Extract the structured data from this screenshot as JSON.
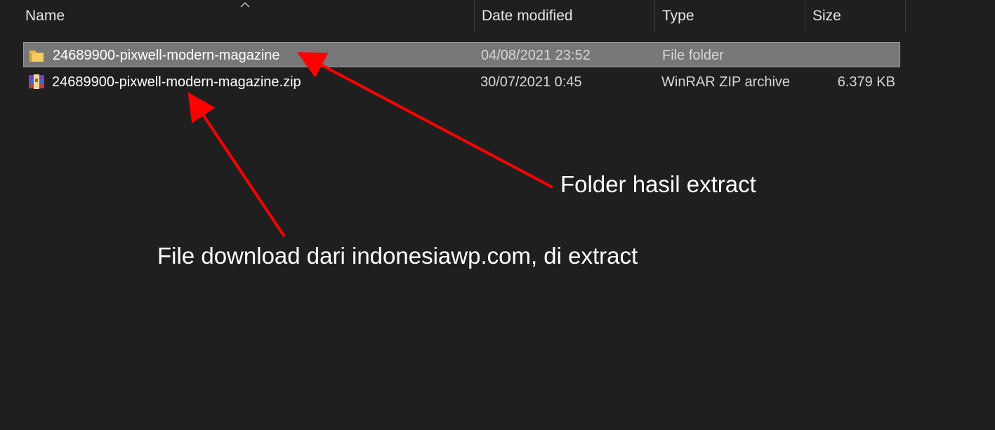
{
  "columns": {
    "name": "Name",
    "date_modified": "Date modified",
    "type": "Type",
    "size": "Size",
    "sort_icon": "chevron-up-icon"
  },
  "files": [
    {
      "name": "24689900-pixwell-modern-magazine",
      "date_modified": "04/08/2021 23:52",
      "type": "File folder",
      "size": "",
      "icon": "folder-icon",
      "selected": true
    },
    {
      "name": "24689900-pixwell-modern-magazine.zip",
      "date_modified": "30/07/2021 0:45",
      "type": "WinRAR ZIP archive",
      "size": "6.379 KB",
      "icon": "winrar-archive-icon",
      "selected": false
    }
  ],
  "annotations": {
    "folder_label": "Folder hasil extract",
    "zip_label": "File download dari indonesiawp.com, di extract",
    "arrow_color": "#ff0000"
  },
  "colors": {
    "background": "#1f1f1f",
    "selection": "#777777"
  }
}
